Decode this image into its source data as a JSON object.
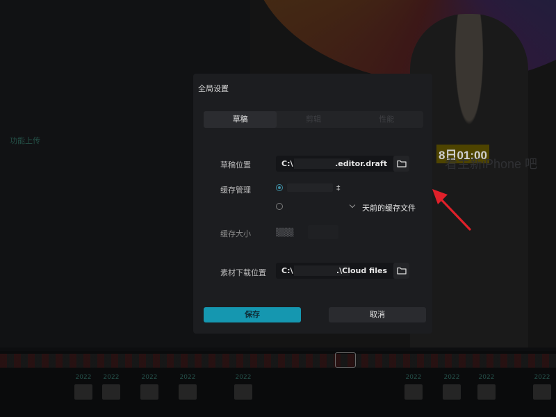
{
  "background": {
    "left_panel_text": "功能上传",
    "preview_time": "8日01:00",
    "preview_subtitle": "看主新iPhone 吧",
    "timeline_clips": [
      {
        "year": "2022"
      },
      {
        "year": "2022"
      },
      {
        "year": "2022"
      },
      {
        "year": "2022"
      },
      {
        "year": "2022"
      },
      {
        "year": "2022"
      },
      {
        "year": "2022"
      },
      {
        "year": "2022"
      },
      {
        "year": "2022"
      }
    ]
  },
  "dialog": {
    "title": "全局设置",
    "tabs": [
      {
        "label": "草稿",
        "active": true
      },
      {
        "label": "剪辑",
        "active": false
      },
      {
        "label": "性能",
        "active": false
      }
    ],
    "draft_location": {
      "label": "草稿位置",
      "path_start": "C:\\",
      "path_end": ".editor.draft"
    },
    "cache_management": {
      "label": "缓存管理",
      "retention_suffix": "天前的缓存文件"
    },
    "cache_size": {
      "label": "缓存大小"
    },
    "download_location": {
      "label": "素材下载位置",
      "path_start": "C:\\",
      "path_end": ".\\Cloud files"
    },
    "save_label": "保存",
    "cancel_label": "取消"
  },
  "colors": {
    "accent": "#1597b0",
    "annotation_arrow": "#e0202a"
  }
}
